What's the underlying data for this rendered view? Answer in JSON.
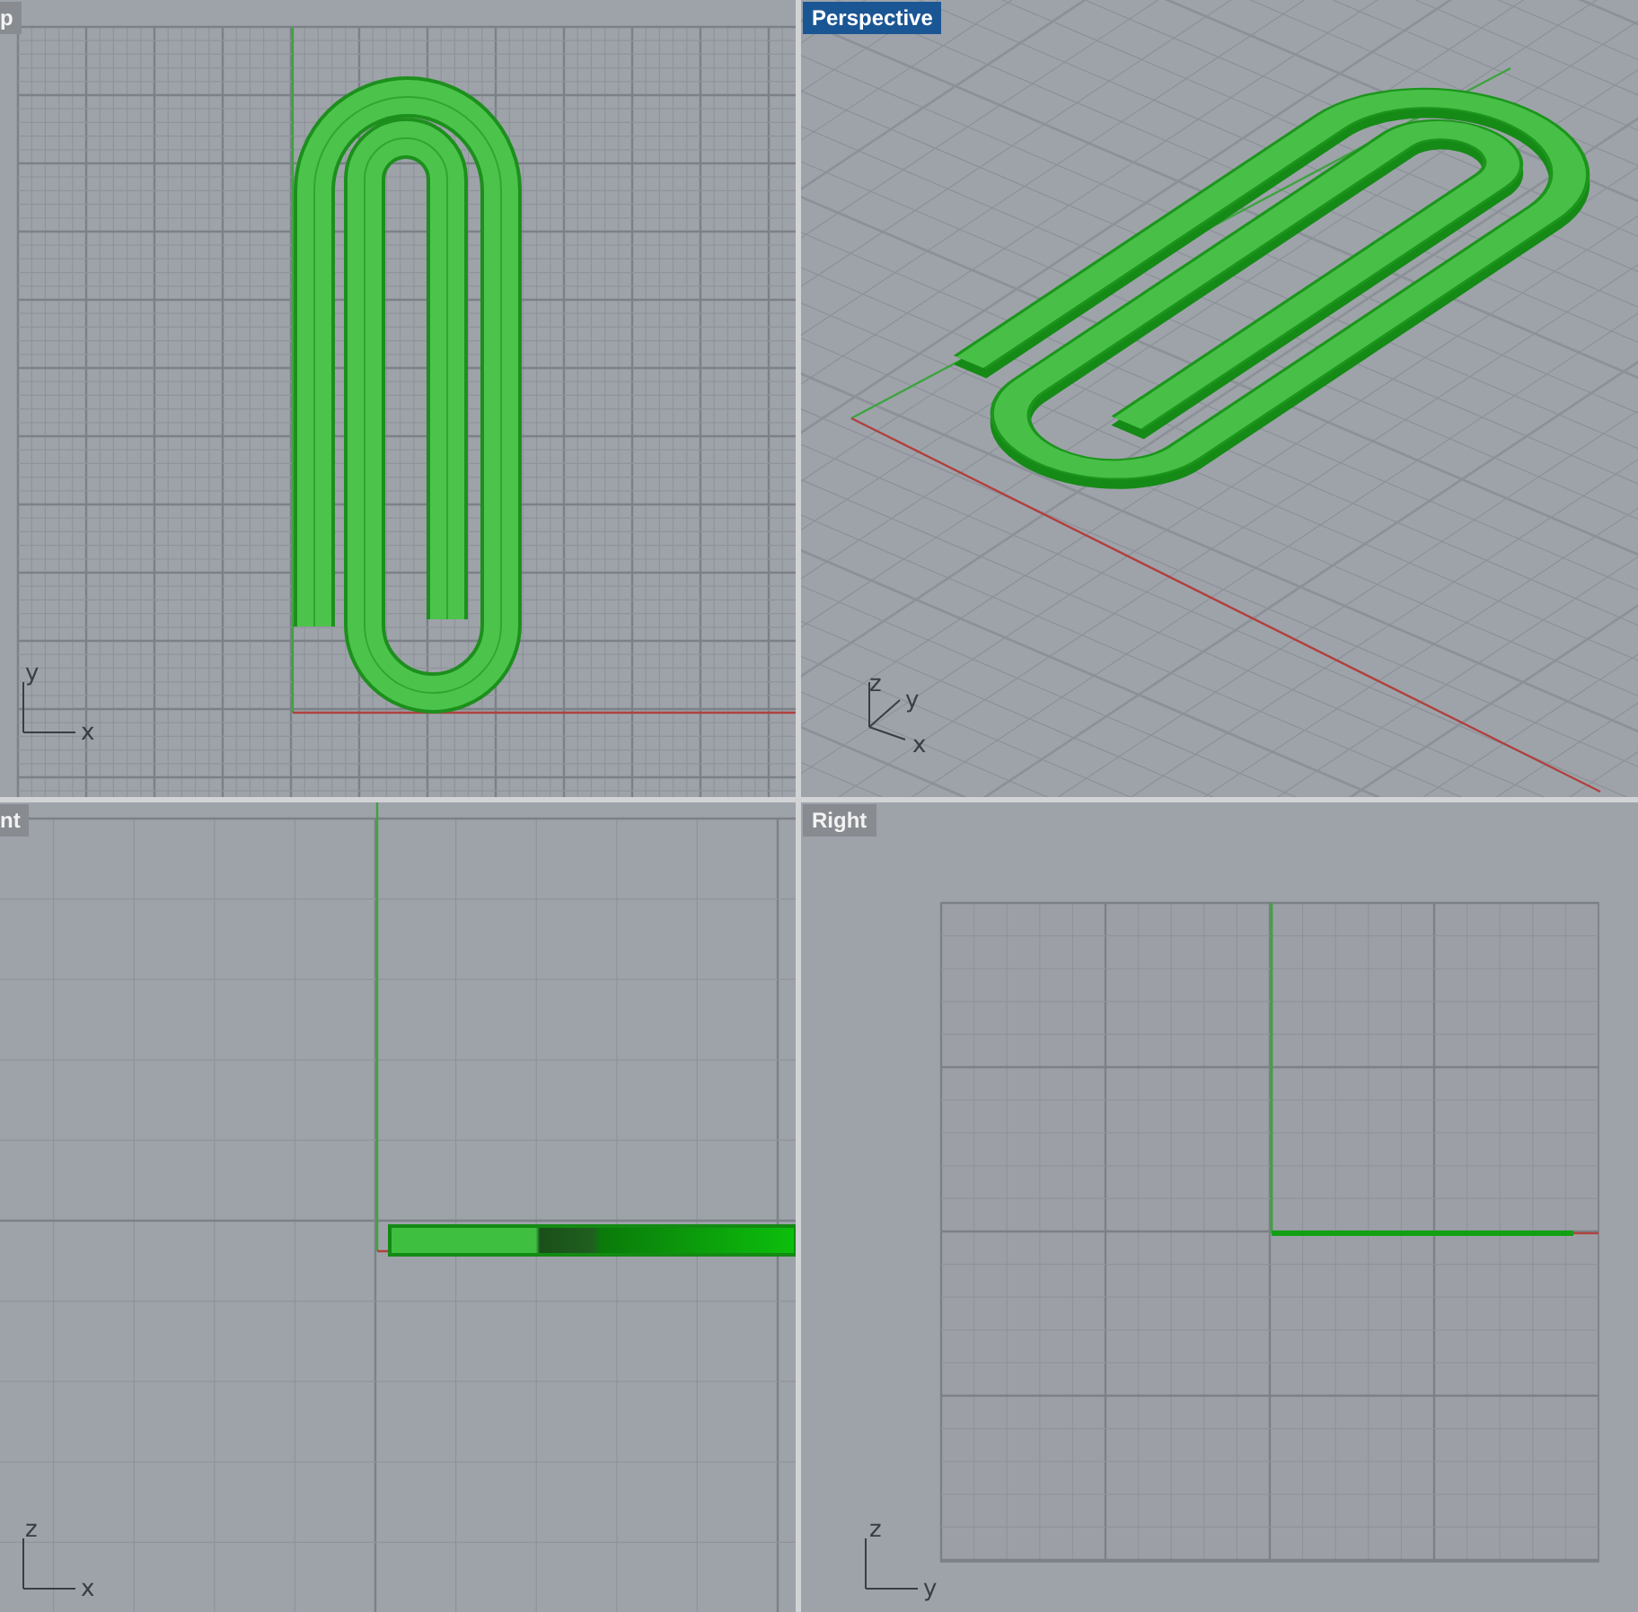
{
  "viewports": [
    {
      "kind": "top",
      "label": "p",
      "selected": false,
      "axes": [
        "y",
        "x"
      ]
    },
    {
      "kind": "perspective",
      "label": "Perspective",
      "selected": true,
      "axes": [
        "z",
        "y",
        "x"
      ]
    },
    {
      "kind": "front",
      "label": "nt",
      "selected": false,
      "axes": [
        "z",
        "x"
      ]
    },
    {
      "kind": "right",
      "label": "Right",
      "selected": false,
      "axes": [
        "z",
        "y"
      ]
    }
  ]
}
